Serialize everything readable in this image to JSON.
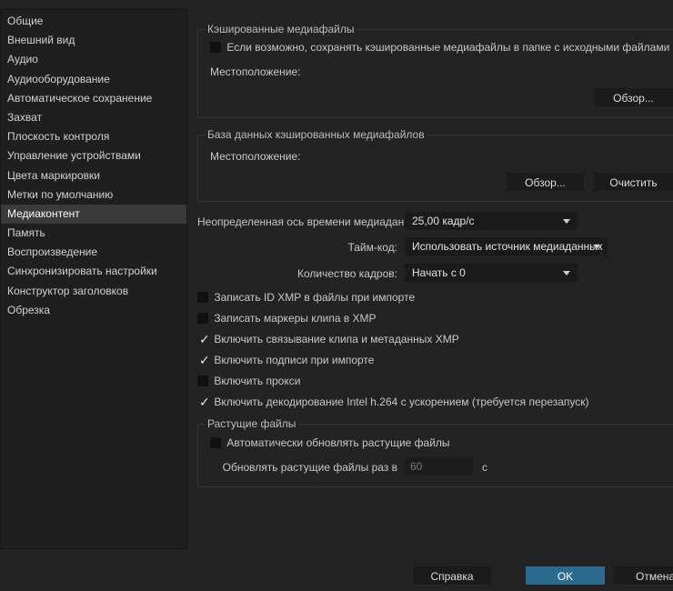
{
  "sidebar": {
    "items": [
      {
        "label": "Общие"
      },
      {
        "label": "Внешний вид"
      },
      {
        "label": "Аудио"
      },
      {
        "label": "Аудиооборудование"
      },
      {
        "label": "Автоматическое сохранение"
      },
      {
        "label": "Захват"
      },
      {
        "label": "Плоскость контроля"
      },
      {
        "label": "Управление устройствами"
      },
      {
        "label": "Цвета маркировки"
      },
      {
        "label": "Метки по умолчанию"
      },
      {
        "label": "Медиаконтент"
      },
      {
        "label": "Память"
      },
      {
        "label": "Воспроизведение"
      },
      {
        "label": "Синхронизировать настройки"
      },
      {
        "label": "Конструктор заголовков"
      },
      {
        "label": "Обрезка"
      }
    ],
    "selected": "Медиаконтент"
  },
  "cached_media": {
    "title": "Кэшированные медиафайлы",
    "save_near_originals_label": "Если возможно, сохранять кэшированные медиафайлы в папке с исходными файлами",
    "location_label": "Местоположение:",
    "browse_label": "Обзор..."
  },
  "cache_db": {
    "title": "База данных кэшированных медиафайлов",
    "location_label": "Местоположение:",
    "browse_label": "Обзор...",
    "clear_label": "Очистить"
  },
  "metadata": {
    "timebase_label": "Неопределенная ось времени медиаданных:",
    "timebase_value": "25,00 кадр/с",
    "timecode_label": "Тайм-код:",
    "timecode_value": "Использовать источник медиаданных",
    "frame_count_label": "Количество кадров:",
    "frame_count_value": "Начать с 0"
  },
  "options": [
    {
      "label": "Записать ID XMP в файлы при импорте",
      "checked": false
    },
    {
      "label": "Записать маркеры клипа в XMP",
      "checked": false
    },
    {
      "label": "Включить связывание клипа и метаданных XMP",
      "checked": true
    },
    {
      "label": "Включить подписи при импорте",
      "checked": true
    },
    {
      "label": "Включить прокси",
      "checked": false
    },
    {
      "label": "Включить декодирование Intel h.264 с ускорением (требуется перезапуск)",
      "checked": true
    }
  ],
  "growing_files": {
    "title": "Растущие файлы",
    "auto_refresh_label": "Автоматически обновлять растущие файлы",
    "refresh_every_label": "Обновлять растущие файлы раз в",
    "refresh_value": "60",
    "unit": "с"
  },
  "footer": {
    "help_label": "Справка",
    "ok_label": "OK",
    "cancel_label": "Отмена"
  },
  "colors": {
    "background": "#232323",
    "accent": "#2c6b8f",
    "selected_item": "#3a3a3a"
  }
}
